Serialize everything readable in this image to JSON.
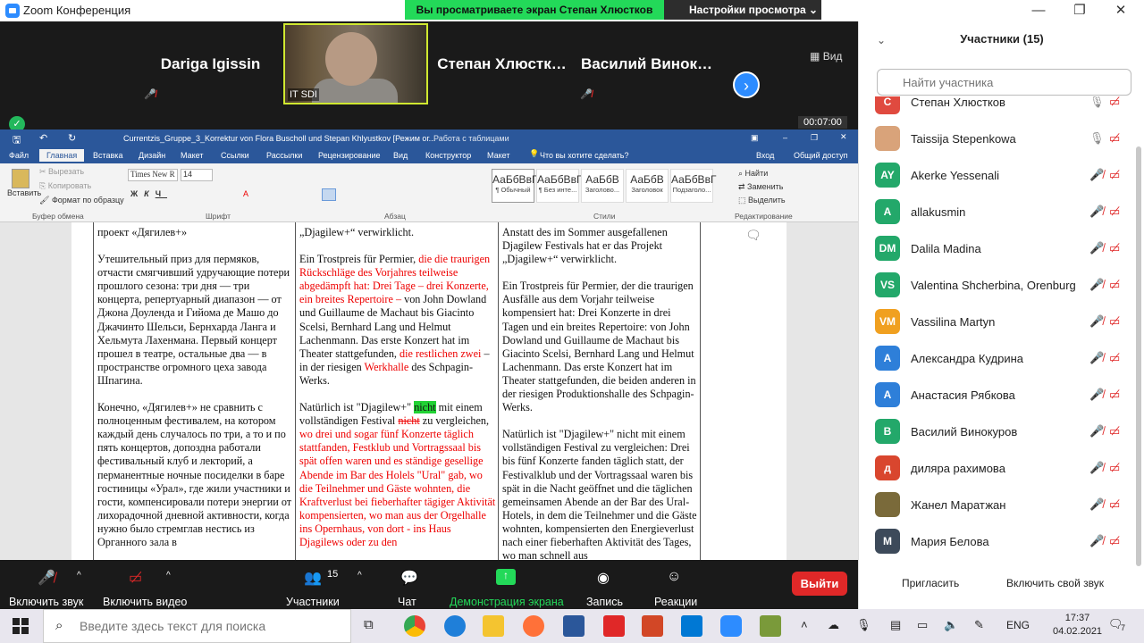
{
  "window": {
    "title": "Zoom Конференция"
  },
  "share_banner": "Вы просматриваете экран Степан Хлюстков",
  "view_options": "Настройки просмотра",
  "view_button": "Вид",
  "tiles": [
    {
      "name": "Dariga Igissin",
      "muted": true
    },
    {
      "name": "IT SDI",
      "muted": false,
      "video": true
    },
    {
      "name": "Степан Хлюстк…",
      "muted": false
    },
    {
      "name": "Василий Винок…",
      "muted": true
    }
  ],
  "timer": "00:07:00",
  "word": {
    "title": "Currentzis_Gruppe_3_Korrektur von Flora Buscholl und Stepan Khlyustkov [Режим ог...",
    "table_tools": "Работа с таблицами",
    "tell_me": "Что вы хотите сделать?",
    "login": "Вход",
    "share": "Общий доступ",
    "tabs": [
      "Файл",
      "Главная",
      "Вставка",
      "Дизайн",
      "Макет",
      "Ссылки",
      "Рассылки",
      "Рецензирование",
      "Вид",
      "Конструктор",
      "Макет"
    ],
    "ribbon": {
      "paste": "Вставить",
      "cut": "Вырезать",
      "copy": "Копировать",
      "format_painter": "Формат по образцу",
      "clipboard_group": "Буфер обмена",
      "font_name": "Times New R",
      "font_size": "14",
      "font_group": "Шрифт",
      "paragraph_group": "Абзац",
      "styles": [
        {
          "sample": "АаБбВвГ",
          "label": "¶ Обычный"
        },
        {
          "sample": "АаБбВвГ",
          "label": "¶ Без инте..."
        },
        {
          "sample": "АаБбВ",
          "label": "Заголово..."
        },
        {
          "sample": "АаБбВ",
          "label": "Заголовок"
        },
        {
          "sample": "АаБбВвГ",
          "label": "Подзаголо..."
        }
      ],
      "styles_group": "Стили",
      "find": "Найти",
      "replace": "Заменить",
      "select": "Выделить",
      "editing_group": "Редактирование"
    }
  },
  "doc": {
    "col1": {
      "p0": "проект «Дягилев+»",
      "p1": "Утешительный приз для пермяков, отчасти смягчивший удручающие потери прошлого сезона: три дня — три концерта, репертуарный диапазон — от Джона Доуленда и Гийома де Машо до Джачинто Шельси, Бернхарда Ланга и Хельмута Лахенмана. Первый концерт прошел в театре, остальные два — в пространстве огромного цеха завода Шпагина.",
      "p2": "Конечно, «Дягилев+» не сравнить с полноценным фестивалем, на котором каждый день случалось по три, а то и по пять концертов, допоздна работали фестивальный клуб и лекторий, а перманентные ночные посиделки в баре гостиницы «Урал», где жили участники и гости, компенсировали потери энергии от лихорадочной дневной активности, когда нужно было стремглав нестись из Органного зала в"
    },
    "col2": {
      "p0": "„Djagilew+“ verwirklicht.",
      "p1a": "Ein Trostpreis für Permier,",
      "p1b": "die die traurigen Rückschläge des Vorjahres teilweise abgedämpft hat: Drei Tage – drei Konzerte, ein breites Repertoire –",
      "p1c": "von John Dowland und Guillaume de Machaut bis Giacinto Scelsi, Bernhard Lang und Helmut Lachenmann. Das erste Konzert hat im Theater stattgefunden,",
      "p1d": "die restlichen zwei",
      "p1e": "– in der riesigen",
      "p1f": "Werkhalle",
      "p1g": "des Schpagin-Werks.",
      "p2a": "Natürlich ist \"Djagilew+\"",
      "p2b": "nicht",
      "p2c": "mit einem vollständigen Festival",
      "p2d": "nicht",
      "p2e": "zu vergleichen,",
      "p2f": "wo drei und sogar fünf Konzerte täglich stattfanden, Festklub und Vortragssaal bis spät offen waren und es ständige gesellige Abende im Bar des Holels \"Ural\" gab, wo die Teilnehmer und Gäste wohnten, die Kraftverlust bei fieberhafter tägiger Aktivität kompensierten, wo man aus der Orgelhalle ins Opernhaus, von dort - ins Haus Djagilews oder zu den"
    },
    "col3": {
      "p0": "Anstatt des im Sommer ausgefallenen Djagilew Festivals hat er das Projekt „Djagilew+“ verwirklicht.",
      "p1": "Ein Trostpreis für Permier, der die traurigen Ausfälle aus dem Vorjahr teilweise kompensiert hat: Drei Konzerte in drei Tagen und ein breites Repertoire: von John Dowland und Guillaume de Machaut bis Giacinto Scelsi, Bernhard Lang und Helmut Lachenmann. Das erste Konzert hat im Theater stattgefunden, die beiden anderen in der riesigen Produktionshalle des Schpagin-Werks.",
      "p2": "Natürlich ist \"Djagilew+\" nicht mit einem vollständigen Festival zu vergleichen: Drei bis fünf Konzerte fanden täglich statt, der Festivalklub und der Vortragssaal waren bis spät in die Nacht geöffnet und die täglichen gemeinsamen Abende an der Bar des Ural-Hotels, in dem die Teilnehmer und die Gäste wohnten, kompensierten den Energieverlust nach einer fieberhaften Aktivität des Tages, wo man schnell aus"
    }
  },
  "controls": {
    "mute": "Включить звук",
    "video": "Включить видео",
    "participants": "Участники",
    "participants_count": "15",
    "chat": "Чат",
    "share": "Демонстрация экрана",
    "record": "Запись",
    "reactions": "Реакции",
    "leave": "Выйти"
  },
  "panel": {
    "title": "Участники (15)",
    "search_placeholder": "Найти участника",
    "participants": [
      {
        "name": "Степан Хлюстков",
        "initials": "С",
        "color": "#e04a3f"
      },
      {
        "name": "Taissija Stepenkowa",
        "initials": "",
        "color": "#d9a37a"
      },
      {
        "name": "Akerke Yessenali",
        "initials": "AY",
        "color": "#23a86a"
      },
      {
        "name": "allakusmin",
        "initials": "A",
        "color": "#23a86a"
      },
      {
        "name": "Dalila Madina",
        "initials": "DM",
        "color": "#23a86a"
      },
      {
        "name": "Valentina Shcherbina, Orenburg",
        "initials": "VS",
        "color": "#23a86a"
      },
      {
        "name": "Vassilina Martyn",
        "initials": "VM",
        "color": "#f0a020"
      },
      {
        "name": "Александра Кудрина",
        "initials": "А",
        "color": "#2e7fd9"
      },
      {
        "name": "Анастасия Рябкова",
        "initials": "А",
        "color": "#2e7fd9"
      },
      {
        "name": "Василий Винокуров",
        "initials": "В",
        "color": "#23a86a"
      },
      {
        "name": "диляра рахимова",
        "initials": "д",
        "color": "#d9462e"
      },
      {
        "name": "Жанел Маратжан",
        "initials": "",
        "color": "#7a6a3a"
      },
      {
        "name": "Мария Белова",
        "initials": "М",
        "color": "#3d4a5a"
      }
    ],
    "invite": "Пригласить",
    "unmute_self": "Включить свой звук"
  },
  "taskbar": {
    "search_placeholder": "Введите здесь текст для поиска",
    "lang": "ENG",
    "time": "17:37",
    "date": "04.02.2021",
    "notif_count": "7"
  }
}
